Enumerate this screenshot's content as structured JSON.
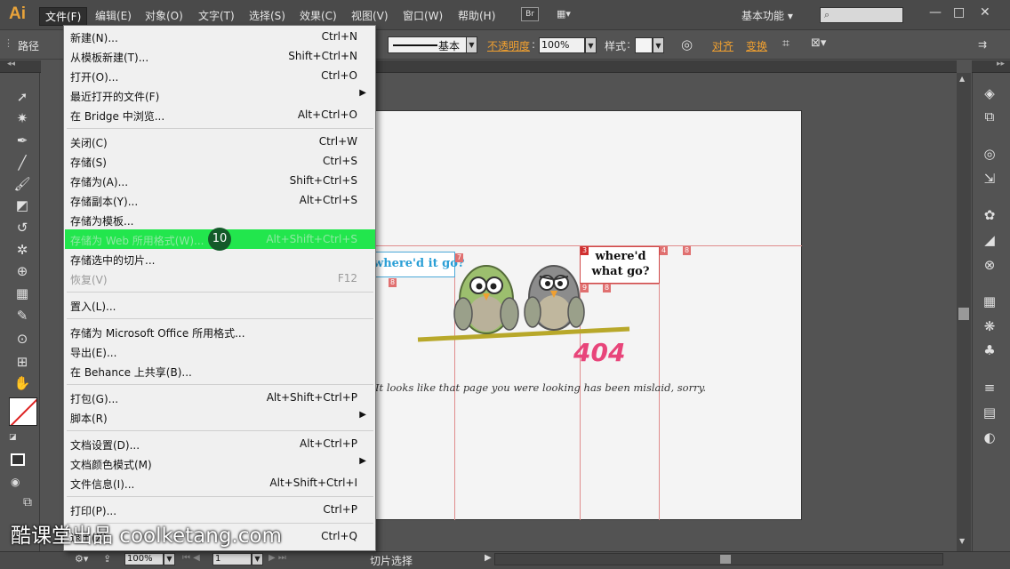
{
  "app": {
    "logo": "Ai"
  },
  "menubar": {
    "items": [
      "文件(F)",
      "编辑(E)",
      "对象(O)",
      "文字(T)",
      "选择(S)",
      "效果(C)",
      "视图(V)",
      "窗口(W)",
      "帮助(H)"
    ],
    "bridge_button": "Br",
    "workspace": "基本功能"
  },
  "controlbar": {
    "path_label": "路径",
    "stroke_style": "基本",
    "opacity_label": "不透明度",
    "opacity_value": "100%",
    "style_label": "样式",
    "align_link": "对齐",
    "transform_link": "变换"
  },
  "file_menu": {
    "items": [
      {
        "label": "新建(N)...",
        "shortcut": "Ctrl+N"
      },
      {
        "label": "从模板新建(T)...",
        "shortcut": "Shift+Ctrl+N"
      },
      {
        "label": "打开(O)...",
        "shortcut": "Ctrl+O"
      },
      {
        "label": "最近打开的文件(F)",
        "shortcut": ""
      },
      {
        "label": "在 Bridge 中浏览...",
        "shortcut": "Alt+Ctrl+O"
      },
      {
        "label": "关闭(C)",
        "shortcut": "Ctrl+W"
      },
      {
        "label": "存储(S)",
        "shortcut": "Ctrl+S"
      },
      {
        "label": "存储为(A)...",
        "shortcut": "Shift+Ctrl+S"
      },
      {
        "label": "存储副本(Y)...",
        "shortcut": "Alt+Ctrl+S"
      },
      {
        "label": "存储为模板...",
        "shortcut": ""
      },
      {
        "label": "存储为 Web 所用格式(W)...",
        "shortcut": "Alt+Shift+Ctrl+S"
      },
      {
        "label": "存储选中的切片...",
        "shortcut": ""
      },
      {
        "label": "恢复(V)",
        "shortcut": "F12"
      },
      {
        "label": "置入(L)...",
        "shortcut": ""
      },
      {
        "label": "存储为 Microsoft Office 所用格式...",
        "shortcut": ""
      },
      {
        "label": "导出(E)...",
        "shortcut": ""
      },
      {
        "label": "在 Behance 上共享(B)...",
        "shortcut": ""
      },
      {
        "label": "打包(G)...",
        "shortcut": "Alt+Shift+Ctrl+P"
      },
      {
        "label": "脚本(R)",
        "shortcut": ""
      },
      {
        "label": "文档设置(D)...",
        "shortcut": "Alt+Ctrl+P"
      },
      {
        "label": "文档颜色模式(M)",
        "shortcut": ""
      },
      {
        "label": "文件信息(I)...",
        "shortcut": "Alt+Shift+Ctrl+I"
      },
      {
        "label": "打印(P)...",
        "shortcut": "Ctrl+P"
      },
      {
        "label": "退出(X)",
        "shortcut": "Ctrl+Q"
      }
    ],
    "step_badge": "10"
  },
  "artwork": {
    "bubble_left": "where'd it go?",
    "bubble_right": "where'd what go?",
    "code": "404",
    "caption": "It looks like that page you were looking has been mislaid, sorry.",
    "slice_tags": [
      "7",
      "8",
      "3",
      "4",
      "8",
      "9",
      "8"
    ]
  },
  "statusbar": {
    "zoom": "100%",
    "page": "1",
    "status": "切片选择"
  },
  "watermark": "酷课堂出品 coolketang.com",
  "colors": {
    "highlight": "#22e64d",
    "accent_orange": "#f0a030",
    "error_pink": "#e8457a"
  }
}
